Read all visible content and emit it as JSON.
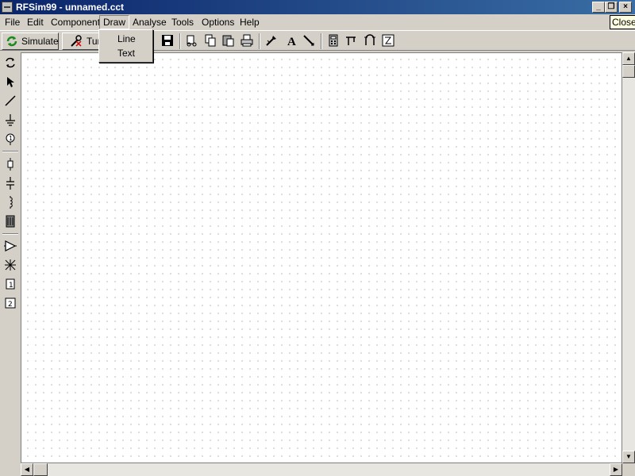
{
  "window": {
    "title": "RFSim99 - unnamed.cct"
  },
  "titlebar_buttons": {
    "minimize": "_",
    "restore": "❐",
    "close": "×"
  },
  "tooltip": "Close",
  "menu": [
    "File",
    "Edit",
    "Component",
    "Draw",
    "Analyse",
    "Tools",
    "Options",
    "Help"
  ],
  "toolbar": {
    "simulate": "Simulate",
    "tune": "Tun"
  },
  "dropdown": {
    "items": [
      "Line",
      "Text"
    ]
  },
  "scroll": {
    "up": "▲",
    "down": "▼",
    "left": "◀",
    "right": "▶"
  }
}
